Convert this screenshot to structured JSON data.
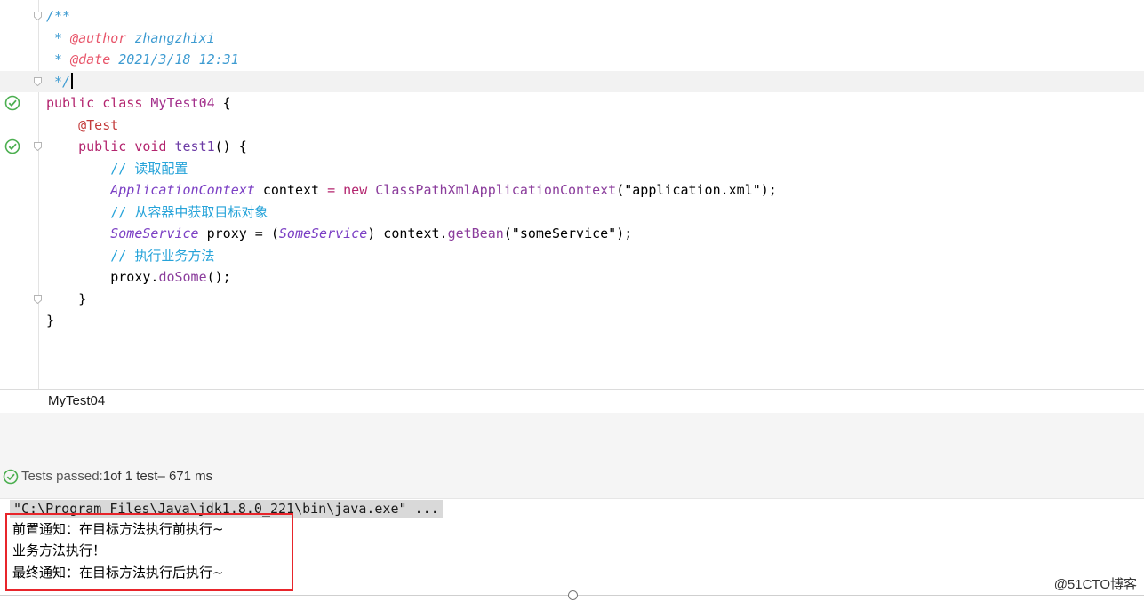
{
  "editor": {
    "lines": [
      {
        "segments": [
          {
            "t": "/**",
            "c": "tok-doc"
          }
        ]
      },
      {
        "segments": [
          {
            "t": " * ",
            "c": "tok-doc"
          },
          {
            "t": "@author",
            "c": "tok-tag"
          },
          {
            "t": " zhangzhixi",
            "c": "tok-doc"
          }
        ]
      },
      {
        "segments": [
          {
            "t": " * ",
            "c": "tok-doc"
          },
          {
            "t": "@date",
            "c": "tok-tag"
          },
          {
            "t": " 2021/3/18 12:31",
            "c": "tok-doc"
          }
        ]
      },
      {
        "segments": [
          {
            "t": " */",
            "c": "tok-doc"
          }
        ],
        "current": true,
        "caret": true
      },
      {
        "segments": [
          {
            "t": "public class ",
            "c": "tok-kw"
          },
          {
            "t": "MyTest04",
            "c": "tok-cls"
          },
          {
            "t": " {",
            "c": ""
          }
        ],
        "run": true
      },
      {
        "segments": [
          {
            "t": "    ",
            "c": ""
          },
          {
            "t": "@Test",
            "c": "tok-ann"
          }
        ]
      },
      {
        "segments": [
          {
            "t": "    ",
            "c": ""
          },
          {
            "t": "public void ",
            "c": "tok-kw"
          },
          {
            "t": "test1",
            "c": "tok-meth"
          },
          {
            "t": "() {",
            "c": ""
          }
        ],
        "run": true
      },
      {
        "segments": [
          {
            "t": "        // 读取配置",
            "c": "tok-cmt"
          }
        ]
      },
      {
        "segments": [
          {
            "t": "        ",
            "c": ""
          },
          {
            "t": "ApplicationContext",
            "c": "tok-type"
          },
          {
            "t": " context ",
            "c": ""
          },
          {
            "t": "= ",
            "c": "tok-kw"
          },
          {
            "t": "new ",
            "c": "tok-kw"
          },
          {
            "t": "ClassPathXmlApplicationContext",
            "c": "tok-cls2"
          },
          {
            "t": "(\"application.xml\");",
            "c": "tok-str"
          }
        ]
      },
      {
        "segments": [
          {
            "t": "        // 从容器中获取目标对象",
            "c": "tok-cmt"
          }
        ]
      },
      {
        "segments": [
          {
            "t": "        ",
            "c": ""
          },
          {
            "t": "SomeService",
            "c": "tok-type"
          },
          {
            "t": " proxy = (",
            "c": ""
          },
          {
            "t": "SomeService",
            "c": "tok-type"
          },
          {
            "t": ") context.",
            "c": ""
          },
          {
            "t": "getBean",
            "c": "tok-call"
          },
          {
            "t": "(\"someService\");",
            "c": ""
          }
        ]
      },
      {
        "segments": [
          {
            "t": "        // 执行业务方法",
            "c": "tok-cmt"
          }
        ]
      },
      {
        "segments": [
          {
            "t": "        proxy.",
            "c": ""
          },
          {
            "t": "doSome",
            "c": "tok-call"
          },
          {
            "t": "();",
            "c": ""
          }
        ]
      },
      {
        "segments": [
          {
            "t": "    }",
            "c": ""
          }
        ]
      },
      {
        "segments": [
          {
            "t": "}",
            "c": ""
          }
        ]
      }
    ],
    "fold_lines": [
      0,
      3,
      6,
      13
    ]
  },
  "run_panel": {
    "tab_label": "MyTest04",
    "status_prefix": "Tests passed: ",
    "status_count": "1",
    "status_middle": " of 1 test",
    "status_time": " – 671 ms"
  },
  "console": {
    "command": "\"C:\\Program Files\\Java\\jdk1.8.0_221\\bin\\java.exe\" ...",
    "output": [
      "前置通知：在目标方法执行前执行~",
      "业务方法执行！",
      "最终通知：在目标方法执行后执行~"
    ]
  },
  "watermark": "@51CTO博客",
  "colors": {
    "highlight_box": "#e8252b",
    "pass_green": "#4caf50"
  }
}
